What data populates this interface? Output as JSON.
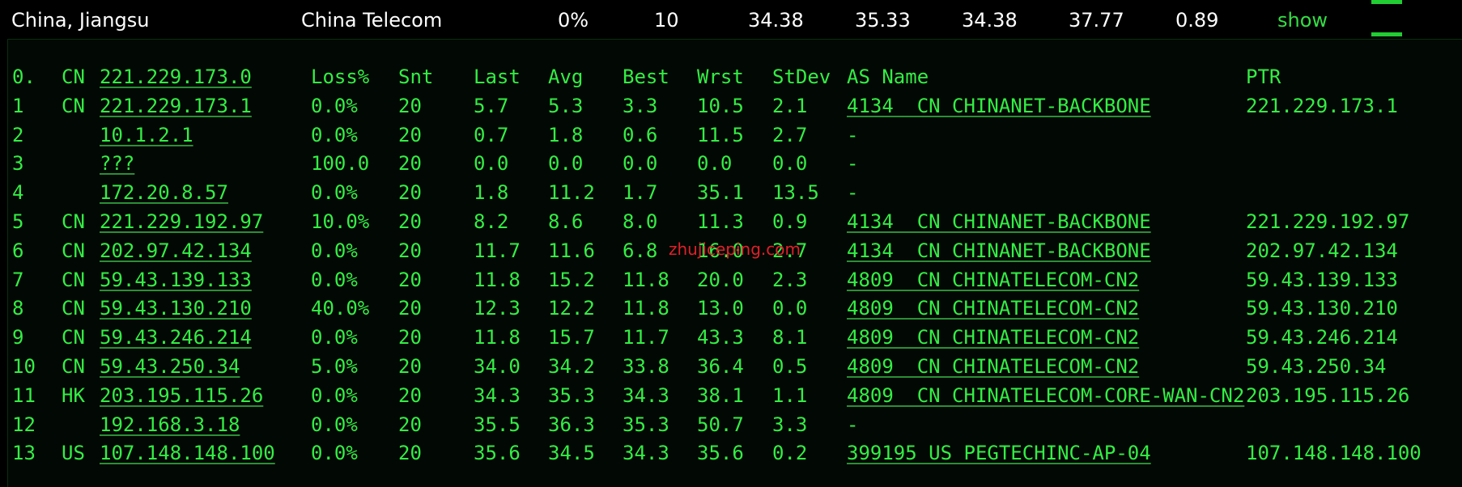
{
  "summary": {
    "location": "China, Jiangsu",
    "isp": "China Telecom",
    "loss": "0%",
    "sent": "10",
    "last": "34.38",
    "avg": "35.33",
    "best": "34.38",
    "worst": "37.77",
    "stdev": "0.89",
    "action_label": "show"
  },
  "headers": {
    "index": "0.",
    "cc": "CN",
    "host": "221.229.173.0",
    "loss": "Loss%",
    "snt": "Snt",
    "last": "Last",
    "avg": "Avg",
    "best": "Best",
    "wrst": "Wrst",
    "stdev": "StDev",
    "as_name": "AS Name",
    "ptr": "PTR"
  },
  "hops": [
    {
      "n": "1",
      "cc": "CN",
      "host": "221.229.173.1",
      "loss": "0.0%",
      "snt": "20",
      "last": "5.7",
      "avg": "5.3",
      "best": "3.3",
      "wrst": "10.5",
      "stdev": "2.1",
      "as": "4134  CN CHINANET-BACKBONE",
      "ptr": "221.229.173.1"
    },
    {
      "n": "2",
      "cc": "",
      "host": "10.1.2.1",
      "loss": "0.0%",
      "snt": "20",
      "last": "0.7",
      "avg": "1.8",
      "best": "0.6",
      "wrst": "11.5",
      "stdev": "2.7",
      "as": "-",
      "ptr": ""
    },
    {
      "n": "3",
      "cc": "",
      "host": "???",
      "loss": "100.0",
      "snt": "20",
      "last": "0.0",
      "avg": "0.0",
      "best": "0.0",
      "wrst": "0.0",
      "stdev": "0.0",
      "as": "-",
      "ptr": ""
    },
    {
      "n": "4",
      "cc": "",
      "host": "172.20.8.57",
      "loss": "0.0%",
      "snt": "20",
      "last": "1.8",
      "avg": "11.2",
      "best": "1.7",
      "wrst": "35.1",
      "stdev": "13.5",
      "as": "-",
      "ptr": ""
    },
    {
      "n": "5",
      "cc": "CN",
      "host": "221.229.192.97",
      "loss": "10.0%",
      "snt": "20",
      "last": "8.2",
      "avg": "8.6",
      "best": "8.0",
      "wrst": "11.3",
      "stdev": "0.9",
      "as": "4134  CN CHINANET-BACKBONE",
      "ptr": "221.229.192.97"
    },
    {
      "n": "6",
      "cc": "CN",
      "host": "202.97.42.134",
      "loss": "0.0%",
      "snt": "20",
      "last": "11.7",
      "avg": "11.6",
      "best": "6.8",
      "wrst": "16.0",
      "stdev": "2.7",
      "as": "4134  CN CHINANET-BACKBONE",
      "ptr": "202.97.42.134"
    },
    {
      "n": "7",
      "cc": "CN",
      "host": "59.43.139.133",
      "loss": "0.0%",
      "snt": "20",
      "last": "11.8",
      "avg": "15.2",
      "best": "11.8",
      "wrst": "20.0",
      "stdev": "2.3",
      "as": "4809  CN CHINATELECOM-CN2",
      "ptr": "59.43.139.133"
    },
    {
      "n": "8",
      "cc": "CN",
      "host": "59.43.130.210",
      "loss": "40.0%",
      "snt": "20",
      "last": "12.3",
      "avg": "12.2",
      "best": "11.8",
      "wrst": "13.0",
      "stdev": "0.0",
      "as": "4809  CN CHINATELECOM-CN2",
      "ptr": "59.43.130.210"
    },
    {
      "n": "9",
      "cc": "CN",
      "host": "59.43.246.214",
      "loss": "0.0%",
      "snt": "20",
      "last": "11.8",
      "avg": "15.7",
      "best": "11.7",
      "wrst": "43.3",
      "stdev": "8.1",
      "as": "4809  CN CHINATELECOM-CN2",
      "ptr": "59.43.246.214"
    },
    {
      "n": "10",
      "cc": "CN",
      "host": "59.43.250.34",
      "loss": "5.0%",
      "snt": "20",
      "last": "34.0",
      "avg": "34.2",
      "best": "33.8",
      "wrst": "36.4",
      "stdev": "0.5",
      "as": "4809  CN CHINATELECOM-CN2",
      "ptr": "59.43.250.34"
    },
    {
      "n": "11",
      "cc": "HK",
      "host": "203.195.115.26",
      "loss": "0.0%",
      "snt": "20",
      "last": "34.3",
      "avg": "35.3",
      "best": "34.3",
      "wrst": "38.1",
      "stdev": "1.1",
      "as": "4809  CN CHINATELECOM-CORE-WAN-CN2",
      "ptr": "203.195.115.26"
    },
    {
      "n": "12",
      "cc": "",
      "host": "192.168.3.18",
      "loss": "0.0%",
      "snt": "20",
      "last": "35.5",
      "avg": "36.3",
      "best": "35.3",
      "wrst": "50.7",
      "stdev": "3.3",
      "as": "-",
      "ptr": ""
    },
    {
      "n": "13",
      "cc": "US",
      "host": "107.148.148.100",
      "loss": "0.0%",
      "snt": "20",
      "last": "35.6",
      "avg": "34.5",
      "best": "34.3",
      "wrst": "35.6",
      "stdev": "0.2",
      "as": "399195 US PEGTECHINC-AP-04",
      "ptr": "107.148.148.100"
    }
  ],
  "watermark": "zhujiceping.com",
  "colors": {
    "terminal_text": "#33ee44",
    "summary_text": "#ffffff",
    "link": "#33dd44",
    "watermark": "#e0202a"
  }
}
